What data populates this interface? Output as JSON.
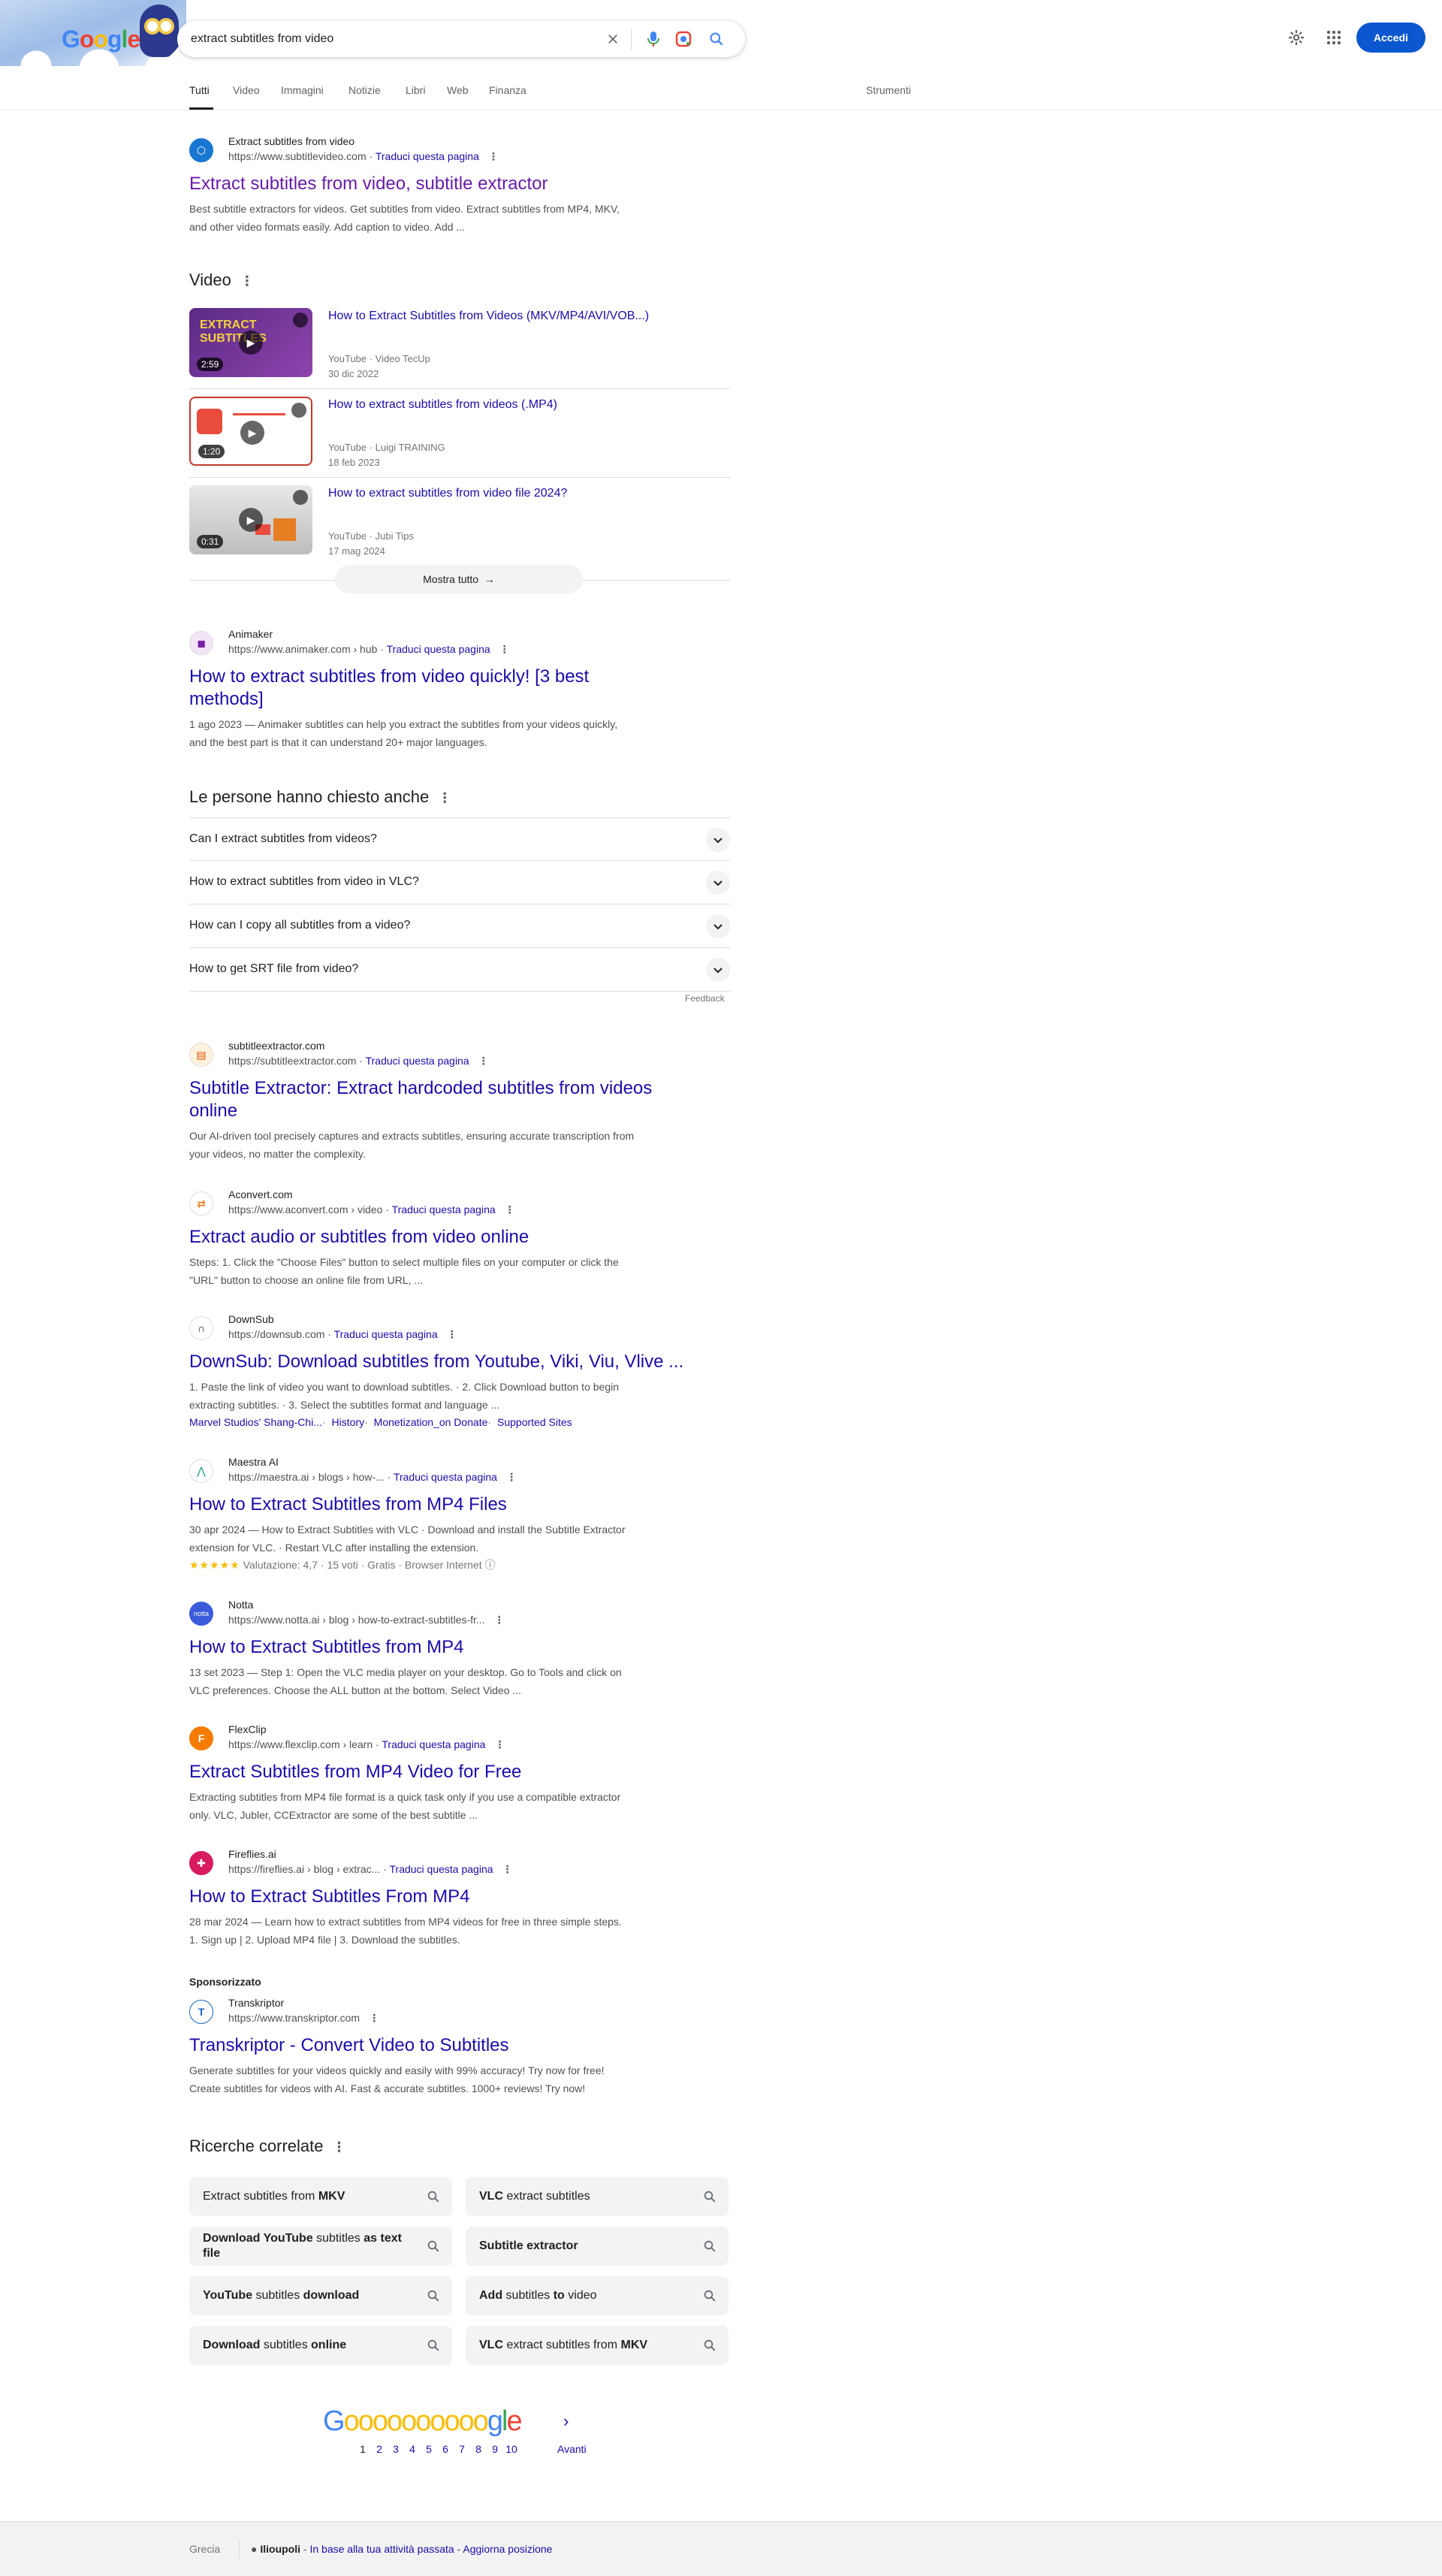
{
  "search": {
    "query": "extract subtitles from video",
    "logo_text": "Google"
  },
  "header": {
    "signin_label": "Accedi"
  },
  "tabs": [
    {
      "label": "Tutti"
    },
    {
      "label": "Video"
    },
    {
      "label": "Immagini"
    },
    {
      "label": "Notizie"
    },
    {
      "label": "Libri"
    },
    {
      "label": "Web"
    },
    {
      "label": "Finanza"
    }
  ],
  "tools_label": "Strumenti",
  "translate_label": "Traduci questa pagina",
  "results": {
    "r1": {
      "site": "Extract subtitles from video",
      "url": "https://www.subtitlevideo.com",
      "title": "Extract subtitles from video, subtitle extractor",
      "snippet_line1": "Best subtitle extractors for videos. Get subtitles from video. Extract subtitles from MP4, MKV,",
      "snippet_line2": "and other video formats easily. Add caption to video. Add ..."
    },
    "r2": {
      "site": "Animaker",
      "url": "https://www.animaker.com › hub",
      "title_line1": "How to extract subtitles from video quickly! [3 best",
      "title_line2": "methods]",
      "snippet_line1": "1 ago 2023 — Animaker subtitles can help you extract the subtitles from your videos quickly,",
      "snippet_line2": "and the best part is that it can understand 20+ major languages."
    },
    "r3": {
      "site": "subtitleextractor.com",
      "url": "https://subtitleextractor.com",
      "title_line1": "Subtitle Extractor: Extract hardcoded subtitles from videos",
      "title_line2": "online",
      "snippet_line1": "Our AI-driven tool precisely captures and extracts subtitles, ensuring accurate transcription from",
      "snippet_line2": "your videos, no matter the complexity."
    },
    "r4": {
      "site": "Aconvert.com",
      "url": "https://www.aconvert.com › video",
      "title": "Extract audio or subtitles from video online",
      "snippet_line1": "Steps: 1. Click the \"Choose Files\" button to select multiple files on your computer or click the",
      "snippet_line2": "\"URL\" button to choose an online file from URL, ..."
    },
    "r5": {
      "site": "DownSub",
      "url": "https://downsub.com",
      "title": "DownSub: Download subtitles from Youtube, Viki, Viu, Vlive ...",
      "snippet_line1": "1. Paste the link of video you want to download subtitles. · 2. Click Download button to begin",
      "snippet_line2": "extracting subtitles. · 3. Select the subtitles format and language ...",
      "sitelinks": [
        "Marvel Studios' Shang-Chi...",
        "History",
        "Monetization_on Donate",
        "Supported Sites"
      ]
    },
    "r6": {
      "site": "Maestra AI",
      "url": "https://maestra.ai › blogs › how-...",
      "title": "How to Extract Subtitles from MP4 Files",
      "snippet_line1": "30 apr 2024 — How to Extract Subtitles with VLC · Download and install the Subtitle Extractor",
      "snippet_line2": "extension for VLC. · Restart VLC after installing the extension.",
      "rating_stars": "★★★★★",
      "rating_text": "Valutazione: 4,7 · 15 voti · Gratis · Browser Internet"
    },
    "r7": {
      "site": "Notta",
      "url": "https://www.notta.ai › blog › how-to-extract-subtitles-fr...",
      "title": "How to Extract Subtitles from MP4",
      "snippet_line1": "13 set 2023 — Step 1: Open the VLC media player on your desktop. Go to Tools and click on",
      "snippet_line2": "VLC preferences. Choose the ALL button at the bottom. Select Video ..."
    },
    "r8": {
      "site": "FlexClip",
      "url": "https://www.flexclip.com › learn",
      "title": "Extract Subtitles from MP4 Video for Free",
      "snippet_line1": "Extracting subtitles from MP4 file format is a quick task only if you use a compatible extractor",
      "snippet_line2": "only. VLC, Jubler, CCExtractor are some of the best subtitle ..."
    },
    "r9": {
      "site": "Fireflies.ai",
      "url": "https://fireflies.ai › blog › extrac...",
      "title": "How to Extract Subtitles From MP4",
      "snippet_line1": "28 mar 2024 — Learn how to extract subtitles from MP4 videos for free in three simple steps.",
      "snippet_line2": "1. Sign up | 2. Upload MP4 file | 3. Download the subtitles."
    },
    "ad": {
      "label": "Sponsorizzato",
      "site": "Transkriptor",
      "url": "https://www.transkriptor.com",
      "title": "Transkriptor - Convert Video to Subtitles",
      "snippet_line1": "Generate subtitles for your videos quickly and easily with 99% accuracy! Try now for free!",
      "snippet_line2": "Create subtitles for videos with AI. Fast & accurate subtitles. 1000+ reviews! Try now!"
    }
  },
  "videos": {
    "heading": "Video",
    "items": [
      {
        "title": "How to Extract Subtitles from Videos (MKV/MP4/AVI/VOB...)",
        "source": "YouTube · Video TecUp",
        "date": "30 dic 2022",
        "duration": "2:59"
      },
      {
        "title": "How to extract subtitles from videos (.MP4)",
        "source": "YouTube · Luigi TRAINING",
        "date": "18 feb 2023",
        "duration": "1:20"
      },
      {
        "title": "How to extract subtitles from video file 2024?",
        "source": "YouTube · Jubi Tips",
        "date": "17 mag 2024",
        "duration": "0:31"
      }
    ],
    "thumb_text_1": "EXTRACT SUBTITLES",
    "show_all": "Mostra tutto"
  },
  "paa": {
    "heading": "Le persone hanno chiesto anche",
    "questions": [
      "Can I extract subtitles from videos?",
      "How to extract subtitles from video in VLC?",
      "How can I copy all subtitles from a video?",
      "How to get SRT file from video?"
    ],
    "feedback": "Feedback"
  },
  "related": {
    "heading": "Ricerche correlate",
    "items": [
      {
        "html": "Extract subtitles from <b>MKV</b>"
      },
      {
        "html": "<b>VLC</b> extract subtitles"
      },
      {
        "html": "<b>Download YouTube</b> subtitles <b>as text file</b>"
      },
      {
        "html": "<b>Subtitle extractor</b>"
      },
      {
        "html": "<b>YouTube</b> subtitles <b>download</b>"
      },
      {
        "html": "<b>Add</b> subtitles <b>to</b> video"
      },
      {
        "html": "<b>Download</b> subtitles <b>online</b>"
      },
      {
        "html": "<b>VLC</b> extract subtitles from <b>MKV</b>"
      }
    ]
  },
  "pagination": {
    "pages": [
      "1",
      "2",
      "3",
      "4",
      "5",
      "6",
      "7",
      "8",
      "9",
      "10"
    ],
    "next": "Avanti"
  },
  "footer": {
    "country": "Grecia",
    "location": "Ilioupoli",
    "activity": "In base alla tua attività passata",
    "update": "Aggiorna posizione"
  },
  "colors": {
    "link": "#1a0dab",
    "visited": "#681da8",
    "accent": "#0b57d0"
  }
}
